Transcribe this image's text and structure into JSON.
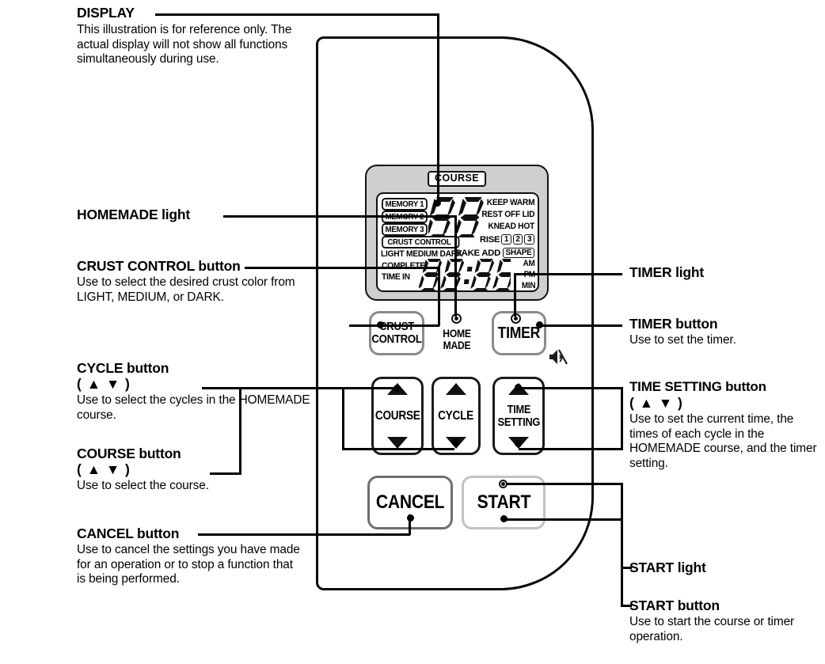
{
  "figure": {
    "kind": "bread-maker-control-panel-diagram"
  },
  "callouts": {
    "display": {
      "title": "DISPLAY",
      "body": "This illustration is for reference only. The actual display will not show all functions simultaneously during use."
    },
    "homemade_light": {
      "title": "HOMEMADE light"
    },
    "crust_control": {
      "title": "CRUST CONTROL button",
      "body": "Use to select the desired crust color from LIGHT, MEDIUM, or DARK."
    },
    "cycle": {
      "title": "CYCLE button",
      "arrows": "( ▲ ▼ )",
      "body": "Use to select the cycles in the HOMEMADE course."
    },
    "course": {
      "title": "COURSE button",
      "arrows": "( ▲ ▼ )",
      "body": "Use to select the course."
    },
    "cancel": {
      "title": "CANCEL button",
      "body": "Use to cancel the settings you have made for an operation or to stop a function that is being performed."
    },
    "timer_light": {
      "title": "TIMER light"
    },
    "timer_button": {
      "title": "TIMER button",
      "body": "Use to set the timer."
    },
    "time_setting": {
      "title": "TIME SETTING button",
      "arrows": "( ▲ ▼ )",
      "body": "Use to set the current time, the times of each cycle in the HOMEMADE course, and the timer setting."
    },
    "start_light": {
      "title": "START light"
    },
    "start_button": {
      "title": "START button",
      "body": "Use to start the course or timer operation."
    }
  },
  "lcd": {
    "course_tag": "COURSE",
    "memory": [
      "MEMORY 1",
      "MEMORY 2",
      "MEMORY 3"
    ],
    "crust_control_tag": "CRUST CONTROL",
    "crust_levels": "LIGHT MEDIUM DARK",
    "complete": "COMPLETE",
    "time_in": "TIME IN",
    "right_labels": [
      "KEEP WARM",
      "REST OFF LID",
      "KNEAD  HOT"
    ],
    "rise_label": "RISE",
    "rise_numbers": [
      "1",
      "2",
      "3"
    ],
    "bake_add": "BAKE ADD",
    "shape": "SHAPE",
    "meridiem": [
      "AM",
      "PM",
      "MIN"
    ],
    "top_digits": "88",
    "clock_digits": "18:88"
  },
  "panel": {
    "buttons": [
      {
        "name": "crust-control",
        "label": "CRUST\nCONTROL"
      },
      {
        "name": "timer",
        "label": "TIMER"
      },
      {
        "name": "course",
        "label": "COURSE"
      },
      {
        "name": "cycle",
        "label": "CYCLE"
      },
      {
        "name": "time-setting",
        "label": "TIME\nSETTING"
      },
      {
        "name": "cancel",
        "label": "CANCEL"
      },
      {
        "name": "start",
        "label": "START"
      }
    ],
    "labels": {
      "crust_control_l1": "CRUST",
      "crust_control_l2": "CONTROL",
      "timer": "TIMER",
      "course": "COURSE",
      "cycle": "CYCLE",
      "time_setting_l1": "TIME",
      "time_setting_l2": "SETTING",
      "cancel": "CANCEL",
      "start": "START",
      "home_made_l1": "HOME",
      "home_made_l2": "MADE"
    },
    "icons": {
      "mute": "mute-speaker-icon",
      "up": "▲",
      "down": "▼"
    }
  },
  "colors": {
    "panel_outline": "#0a0a0a",
    "lcd_bezel": "#cfcfcf",
    "button_grey": "#8a8a8a",
    "button_black": "#1b1b1b",
    "button_light": "#c2c2c2"
  }
}
